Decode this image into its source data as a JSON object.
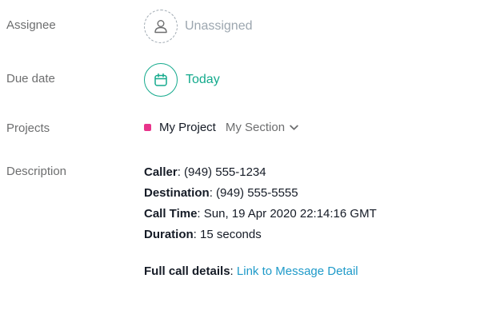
{
  "fields": {
    "assignee_label": "Assignee",
    "due_date_label": "Due date",
    "projects_label": "Projects",
    "description_label": "Description"
  },
  "assignee": {
    "value": "Unassigned",
    "icon": "user-outline-icon"
  },
  "due_date": {
    "value": "Today",
    "icon": "calendar-icon",
    "color": "#14aa8d"
  },
  "project": {
    "name": "My Project",
    "color": "#e8348b",
    "section": "My Section",
    "section_icon": "chevron-down-icon"
  },
  "description": {
    "caller_label": "Caller",
    "caller_value": ": (949) 555-1234",
    "destination_label": "Destination",
    "destination_value": ": (949) 555-5555",
    "call_time_label": "Call Time",
    "call_time_value": ": Sun, 19 Apr 2020 22:14:16 GMT",
    "duration_label": "Duration",
    "duration_value": ": 15 seconds",
    "full_details_label": "Full call details",
    "full_details_sep": ": ",
    "link_text": "Link to Message Detail",
    "link_color": "#1e9ac9"
  }
}
